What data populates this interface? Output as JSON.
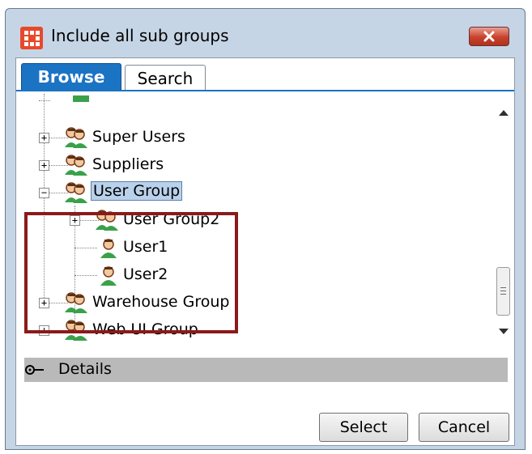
{
  "window": {
    "title": "Include all sub groups",
    "app_icon": "app-grid-icon",
    "close_icon": "close-icon",
    "colors": {
      "titlebar": "#c6d5e6",
      "close": "#c8412b",
      "accent": "#1b73c4",
      "highlight": "#8b1a1a"
    }
  },
  "tabs": [
    {
      "label": "Browse",
      "active": true
    },
    {
      "label": "Search",
      "active": false
    }
  ],
  "tree": {
    "items": [
      {
        "label": "Super Users",
        "icon": "group-icon",
        "expander": "+"
      },
      {
        "label": "Suppliers",
        "icon": "group-icon",
        "expander": "+"
      },
      {
        "label": "User Group",
        "icon": "group-icon",
        "expander": "−",
        "selected": true
      },
      {
        "label": "User Group2",
        "icon": "group-icon",
        "expander": "+"
      },
      {
        "label": "User1",
        "icon": "user-icon"
      },
      {
        "label": "User2",
        "icon": "user-icon"
      },
      {
        "label": "Warehouse Group",
        "icon": "group-icon",
        "expander": "+"
      },
      {
        "label": "Web UI Group",
        "icon": "group-icon",
        "expander": "+"
      }
    ]
  },
  "details": {
    "label": "Details",
    "icon": "key-icon"
  },
  "buttons": {
    "select": "Select",
    "cancel": "Cancel"
  }
}
